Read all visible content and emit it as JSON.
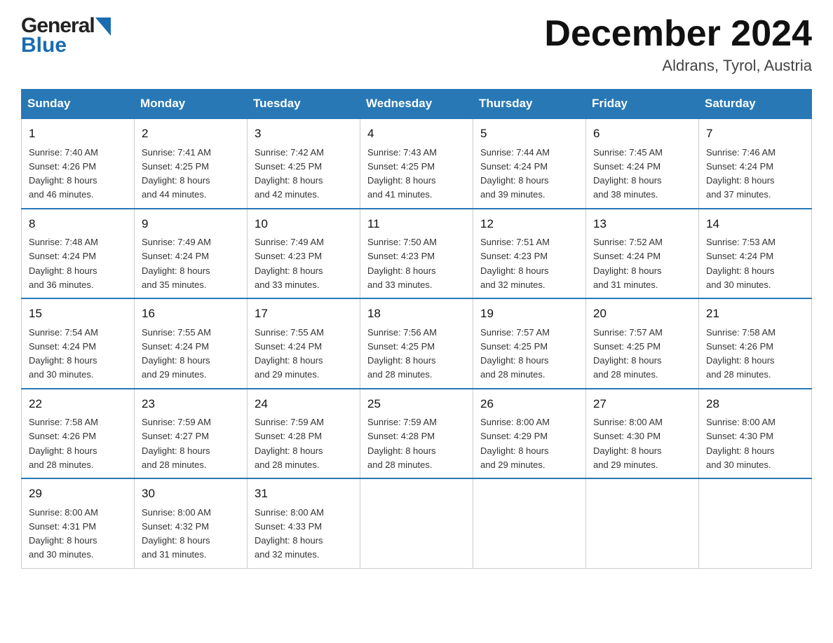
{
  "header": {
    "logo_general": "General",
    "logo_blue": "Blue",
    "month_title": "December 2024",
    "subtitle": "Aldrans, Tyrol, Austria"
  },
  "days_of_week": [
    "Sunday",
    "Monday",
    "Tuesday",
    "Wednesday",
    "Thursday",
    "Friday",
    "Saturday"
  ],
  "weeks": [
    [
      {
        "day": "1",
        "sunrise": "7:40 AM",
        "sunset": "4:26 PM",
        "daylight": "8 hours and 46 minutes."
      },
      {
        "day": "2",
        "sunrise": "7:41 AM",
        "sunset": "4:25 PM",
        "daylight": "8 hours and 44 minutes."
      },
      {
        "day": "3",
        "sunrise": "7:42 AM",
        "sunset": "4:25 PM",
        "daylight": "8 hours and 42 minutes."
      },
      {
        "day": "4",
        "sunrise": "7:43 AM",
        "sunset": "4:25 PM",
        "daylight": "8 hours and 41 minutes."
      },
      {
        "day": "5",
        "sunrise": "7:44 AM",
        "sunset": "4:24 PM",
        "daylight": "8 hours and 39 minutes."
      },
      {
        "day": "6",
        "sunrise": "7:45 AM",
        "sunset": "4:24 PM",
        "daylight": "8 hours and 38 minutes."
      },
      {
        "day": "7",
        "sunrise": "7:46 AM",
        "sunset": "4:24 PM",
        "daylight": "8 hours and 37 minutes."
      }
    ],
    [
      {
        "day": "8",
        "sunrise": "7:48 AM",
        "sunset": "4:24 PM",
        "daylight": "8 hours and 36 minutes."
      },
      {
        "day": "9",
        "sunrise": "7:49 AM",
        "sunset": "4:24 PM",
        "daylight": "8 hours and 35 minutes."
      },
      {
        "day": "10",
        "sunrise": "7:49 AM",
        "sunset": "4:23 PM",
        "daylight": "8 hours and 33 minutes."
      },
      {
        "day": "11",
        "sunrise": "7:50 AM",
        "sunset": "4:23 PM",
        "daylight": "8 hours and 33 minutes."
      },
      {
        "day": "12",
        "sunrise": "7:51 AM",
        "sunset": "4:23 PM",
        "daylight": "8 hours and 32 minutes."
      },
      {
        "day": "13",
        "sunrise": "7:52 AM",
        "sunset": "4:24 PM",
        "daylight": "8 hours and 31 minutes."
      },
      {
        "day": "14",
        "sunrise": "7:53 AM",
        "sunset": "4:24 PM",
        "daylight": "8 hours and 30 minutes."
      }
    ],
    [
      {
        "day": "15",
        "sunrise": "7:54 AM",
        "sunset": "4:24 PM",
        "daylight": "8 hours and 30 minutes."
      },
      {
        "day": "16",
        "sunrise": "7:55 AM",
        "sunset": "4:24 PM",
        "daylight": "8 hours and 29 minutes."
      },
      {
        "day": "17",
        "sunrise": "7:55 AM",
        "sunset": "4:24 PM",
        "daylight": "8 hours and 29 minutes."
      },
      {
        "day": "18",
        "sunrise": "7:56 AM",
        "sunset": "4:25 PM",
        "daylight": "8 hours and 28 minutes."
      },
      {
        "day": "19",
        "sunrise": "7:57 AM",
        "sunset": "4:25 PM",
        "daylight": "8 hours and 28 minutes."
      },
      {
        "day": "20",
        "sunrise": "7:57 AM",
        "sunset": "4:25 PM",
        "daylight": "8 hours and 28 minutes."
      },
      {
        "day": "21",
        "sunrise": "7:58 AM",
        "sunset": "4:26 PM",
        "daylight": "8 hours and 28 minutes."
      }
    ],
    [
      {
        "day": "22",
        "sunrise": "7:58 AM",
        "sunset": "4:26 PM",
        "daylight": "8 hours and 28 minutes."
      },
      {
        "day": "23",
        "sunrise": "7:59 AM",
        "sunset": "4:27 PM",
        "daylight": "8 hours and 28 minutes."
      },
      {
        "day": "24",
        "sunrise": "7:59 AM",
        "sunset": "4:28 PM",
        "daylight": "8 hours and 28 minutes."
      },
      {
        "day": "25",
        "sunrise": "7:59 AM",
        "sunset": "4:28 PM",
        "daylight": "8 hours and 28 minutes."
      },
      {
        "day": "26",
        "sunrise": "8:00 AM",
        "sunset": "4:29 PM",
        "daylight": "8 hours and 29 minutes."
      },
      {
        "day": "27",
        "sunrise": "8:00 AM",
        "sunset": "4:30 PM",
        "daylight": "8 hours and 29 minutes."
      },
      {
        "day": "28",
        "sunrise": "8:00 AM",
        "sunset": "4:30 PM",
        "daylight": "8 hours and 30 minutes."
      }
    ],
    [
      {
        "day": "29",
        "sunrise": "8:00 AM",
        "sunset": "4:31 PM",
        "daylight": "8 hours and 30 minutes."
      },
      {
        "day": "30",
        "sunrise": "8:00 AM",
        "sunset": "4:32 PM",
        "daylight": "8 hours and 31 minutes."
      },
      {
        "day": "31",
        "sunrise": "8:00 AM",
        "sunset": "4:33 PM",
        "daylight": "8 hours and 32 minutes."
      },
      null,
      null,
      null,
      null
    ]
  ],
  "labels": {
    "sunrise": "Sunrise:",
    "sunset": "Sunset:",
    "daylight": "Daylight:"
  }
}
